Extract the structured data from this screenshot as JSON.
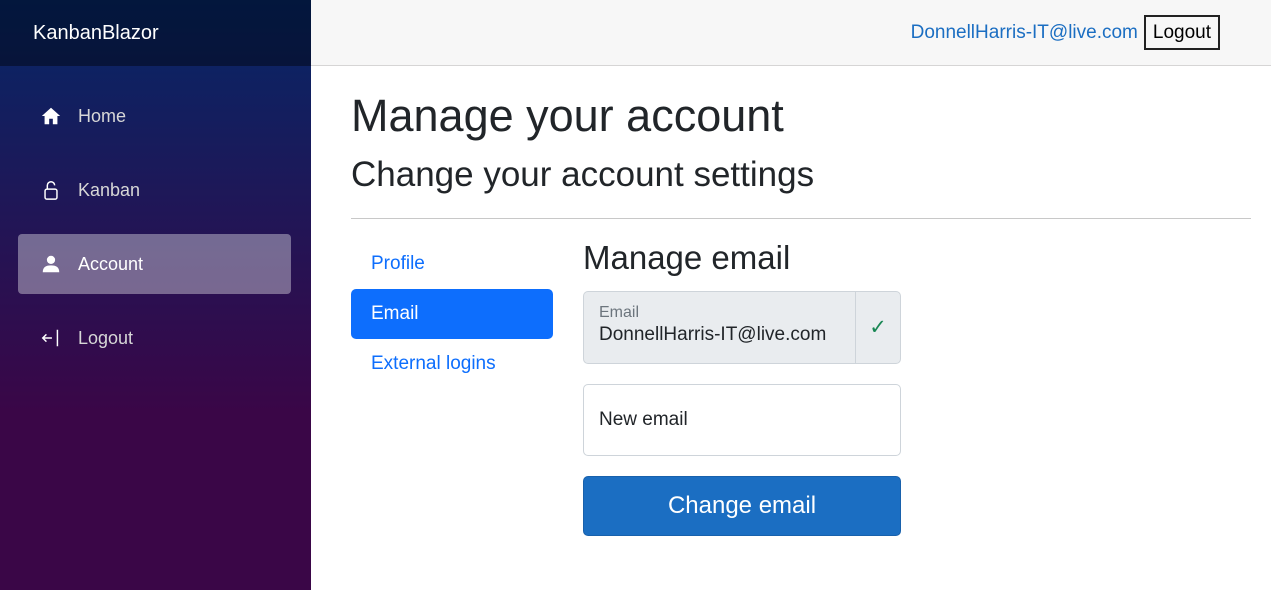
{
  "app": {
    "brand": "KanbanBlazor"
  },
  "sidebar": {
    "items": [
      {
        "label": "Home",
        "icon": "home-icon",
        "active": false
      },
      {
        "label": "Kanban",
        "icon": "lock-icon",
        "active": false
      },
      {
        "label": "Account",
        "icon": "person-icon",
        "active": true
      },
      {
        "label": "Logout",
        "icon": "logout-icon",
        "active": false
      }
    ]
  },
  "header": {
    "user_email": "DonnellHarris-IT@live.com",
    "logout_label": "Logout"
  },
  "page": {
    "title": "Manage your account",
    "subtitle": "Change your account settings"
  },
  "subnav": {
    "items": [
      {
        "label": "Profile",
        "active": false
      },
      {
        "label": "Email",
        "active": true
      },
      {
        "label": "External logins",
        "active": false
      }
    ]
  },
  "form": {
    "section_title": "Manage email",
    "email_label": "Email",
    "email_value": "DonnellHarris-IT@live.com",
    "verified_mark": "✓",
    "new_email_placeholder": "New email",
    "submit_label": "Change email"
  },
  "colors": {
    "accent": "#1b6ec2",
    "active_tab": "#0d6efd",
    "verified": "#198754"
  }
}
